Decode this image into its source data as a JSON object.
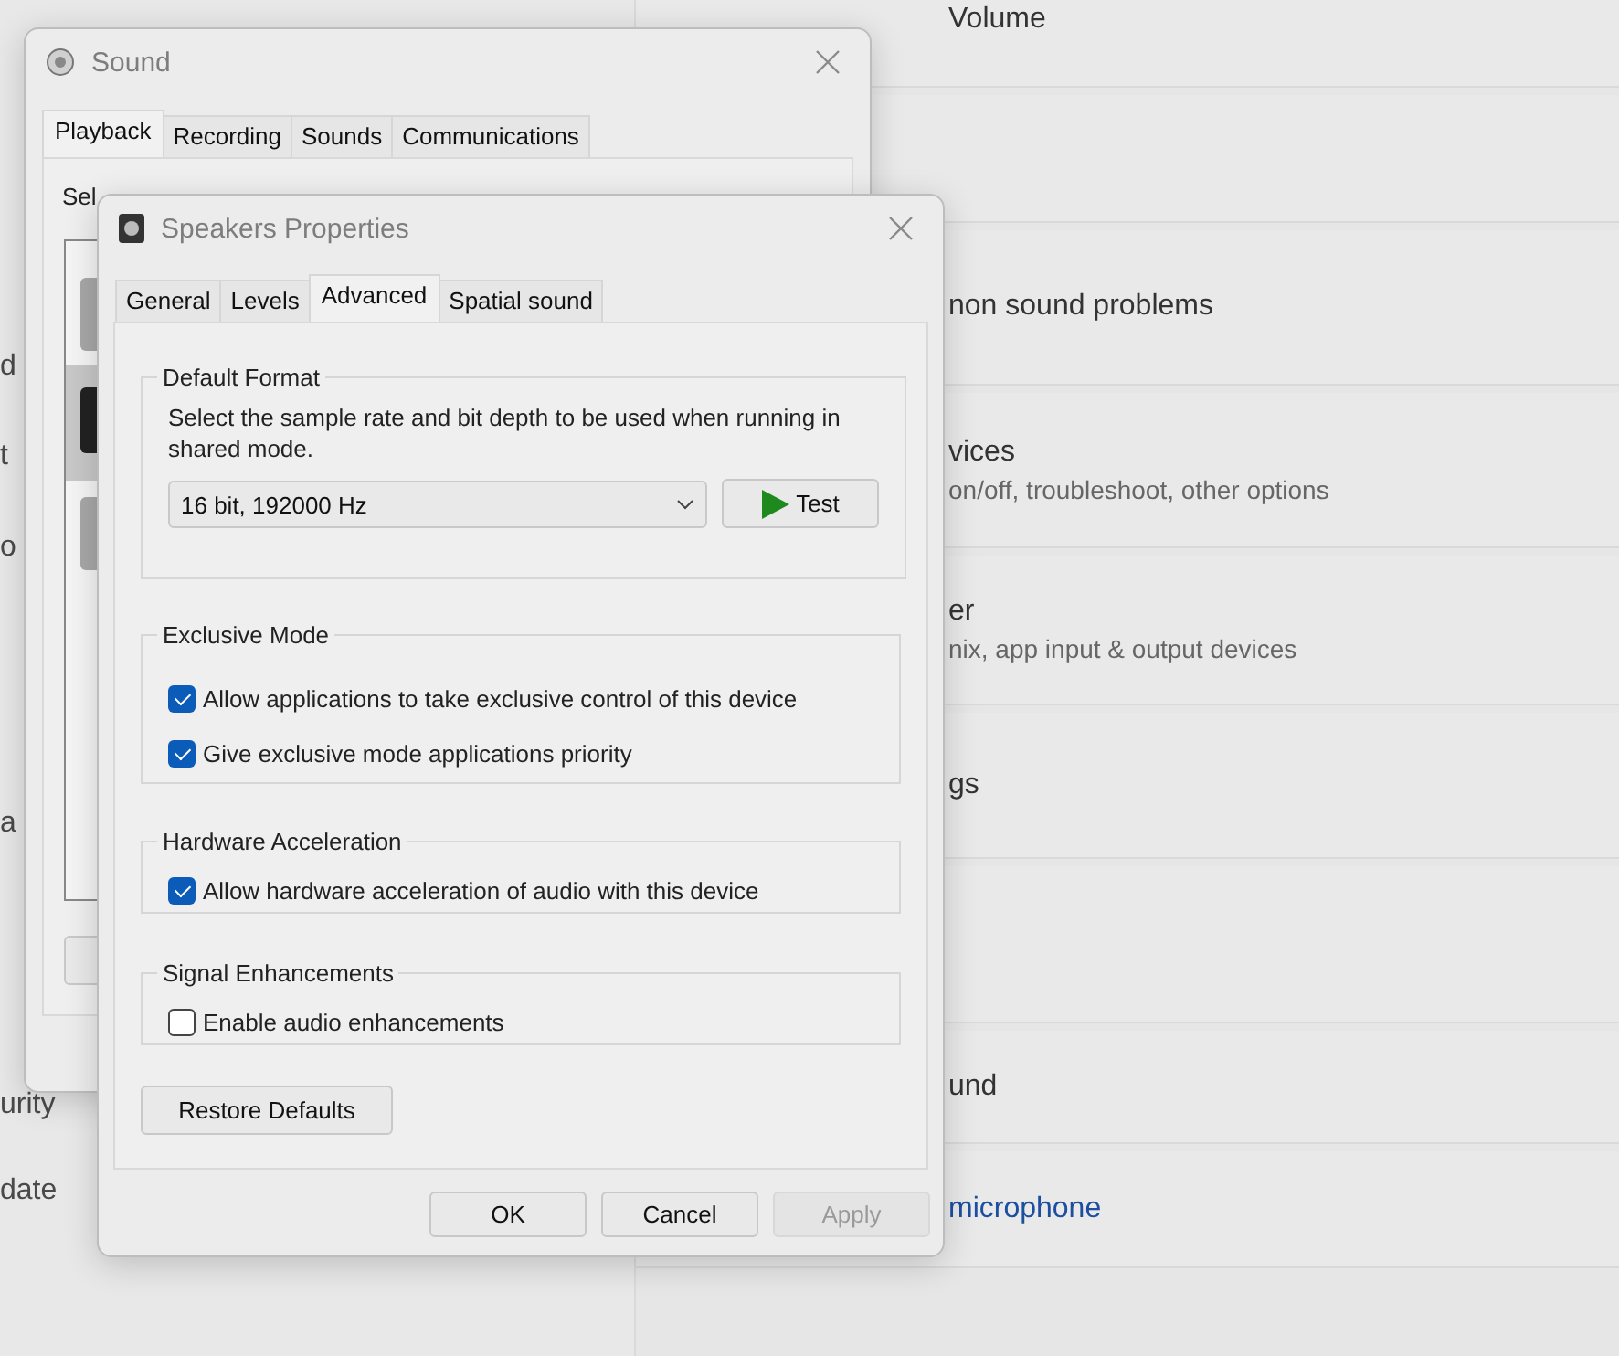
{
  "settings": {
    "left_fragments": [
      "d",
      "t",
      "o",
      "a",
      "urity",
      "date"
    ],
    "rows": [
      {
        "kind": "text",
        "title": "Volume"
      },
      {
        "kind": "blank"
      },
      {
        "kind": "text",
        "title": "non sound problems"
      },
      {
        "kind": "text",
        "title": "vices",
        "subtitle": "on/off, troubleshoot, other options"
      },
      {
        "kind": "text",
        "title": "er",
        "subtitle": "nix, app input & output devices"
      },
      {
        "kind": "text",
        "title": "gs"
      },
      {
        "kind": "blank"
      },
      {
        "kind": "text",
        "title": "und"
      },
      {
        "kind": "link",
        "title": "microphone"
      }
    ]
  },
  "sound_window": {
    "title": "Sound",
    "tabs": [
      {
        "label": "Playback",
        "selected": true
      },
      {
        "label": "Recording",
        "selected": false
      },
      {
        "label": "Sounds",
        "selected": false
      },
      {
        "label": "Communications",
        "selected": false
      }
    ],
    "description": "Sel",
    "devices": [
      {
        "selected": false
      },
      {
        "selected": true
      },
      {
        "selected": false
      }
    ]
  },
  "speakers_window": {
    "title": "Speakers Properties",
    "tabs": [
      {
        "label": "General",
        "selected": false
      },
      {
        "label": "Levels",
        "selected": false
      },
      {
        "label": "Advanced",
        "selected": true
      },
      {
        "label": "Spatial sound",
        "selected": false
      }
    ],
    "groups": [
      {
        "kind": "format",
        "title": "Default Format",
        "description": "Select the sample rate and bit depth to be used when running in shared mode.",
        "format": "16 bit, 192000 Hz",
        "test_button": "Test"
      },
      {
        "kind": "checks",
        "title": "Exclusive Mode",
        "options": [
          {
            "label": "Allow applications to take exclusive control of this device",
            "checked": true
          },
          {
            "label": "Give exclusive mode applications priority",
            "checked": true
          }
        ]
      },
      {
        "kind": "checks",
        "title": "Hardware Acceleration",
        "options": [
          {
            "label": "Allow hardware acceleration of audio with this device",
            "checked": true
          }
        ]
      },
      {
        "kind": "checks",
        "title": "Signal Enhancements",
        "options": [
          {
            "label": "Enable audio enhancements",
            "checked": false
          }
        ]
      }
    ],
    "restore_button": "Restore Defaults",
    "buttons": [
      {
        "label": "OK",
        "disabled": false
      },
      {
        "label": "Cancel",
        "disabled": false
      },
      {
        "label": "Apply",
        "disabled": true
      }
    ]
  }
}
